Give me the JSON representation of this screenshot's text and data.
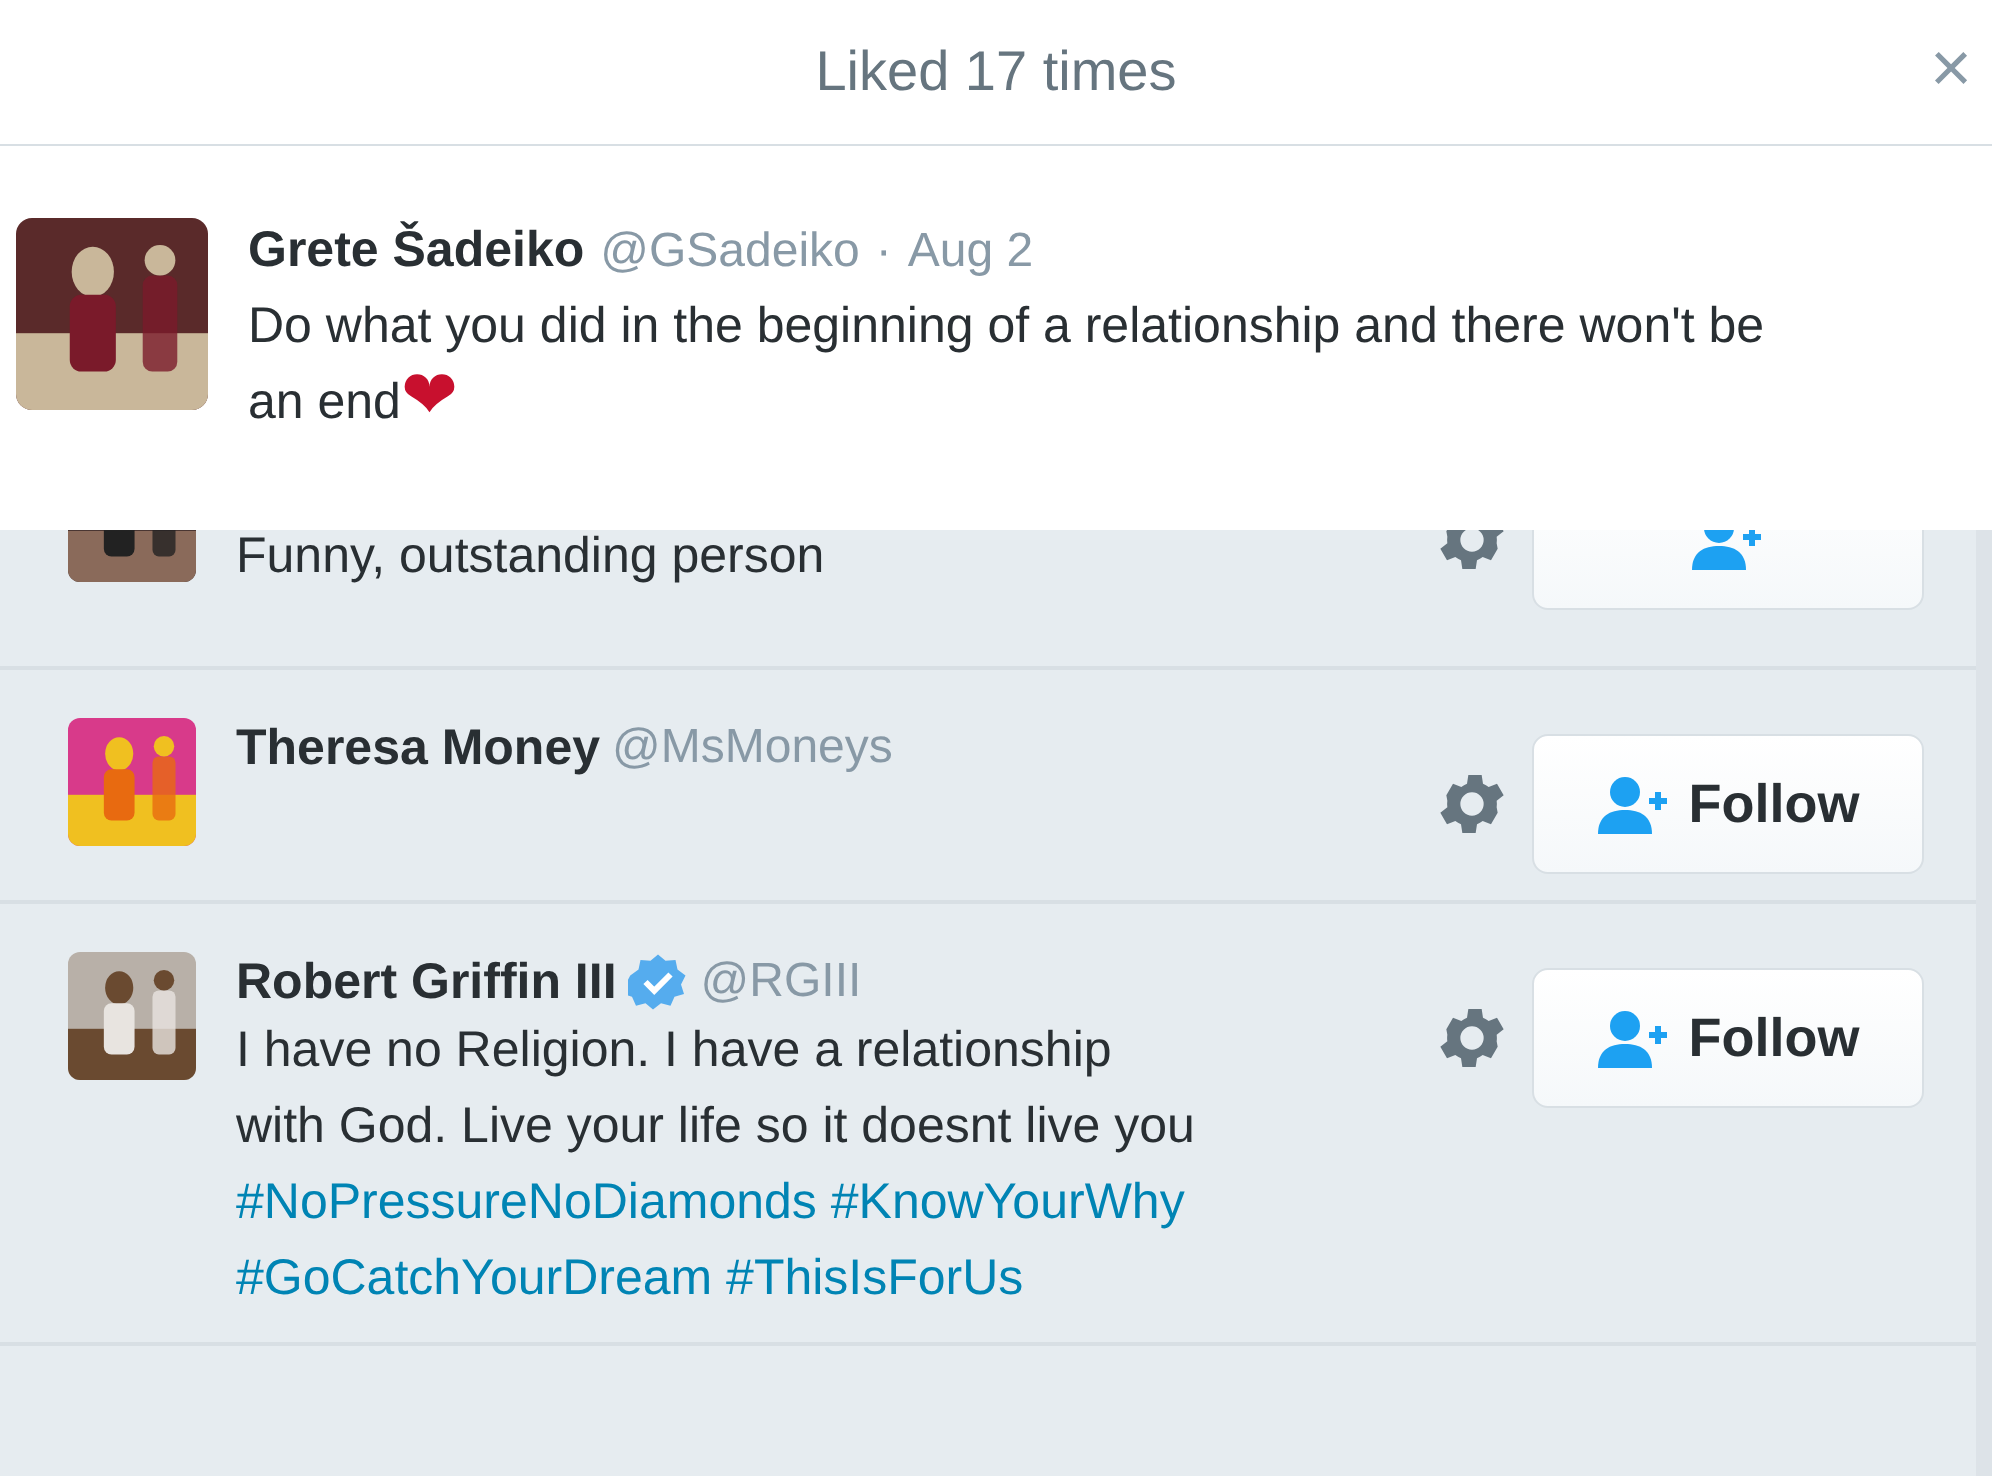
{
  "header": {
    "title": "Liked 17 times",
    "close": "×"
  },
  "tweet": {
    "name": "Grete Šadeiko",
    "handle": "@GSadeiko",
    "separator": "·",
    "date": "Aug 2",
    "text": "Do what you did in the beginning of a relationship and there won't be an end",
    "emoji": "❤"
  },
  "users": [
    {
      "partial": true,
      "bio": [
        {
          "kind": "text",
          "text": "Funny, outstanding person"
        }
      ]
    },
    {
      "partial": false,
      "name": "Theresa Money",
      "verified": false,
      "handle": "@MsMoneys",
      "follow": "Follow"
    },
    {
      "partial": false,
      "name": "Robert Griffin III",
      "verified": true,
      "handle": "@RGIII",
      "bio": [
        {
          "kind": "text",
          "text": "I have no Religion. I have a relationship with God. Live your life so it doesnt live you"
        },
        {
          "kind": "hashtag",
          "text": "#NoPressureNoDiamonds"
        },
        {
          "kind": "hashtag",
          "text": "#KnowYourWhy"
        },
        {
          "kind": "hashtag",
          "text": "#GoCatchYourDream"
        },
        {
          "kind": "hashtag",
          "text": "#ThisIsForUs"
        }
      ],
      "follow": "Follow"
    }
  ]
}
